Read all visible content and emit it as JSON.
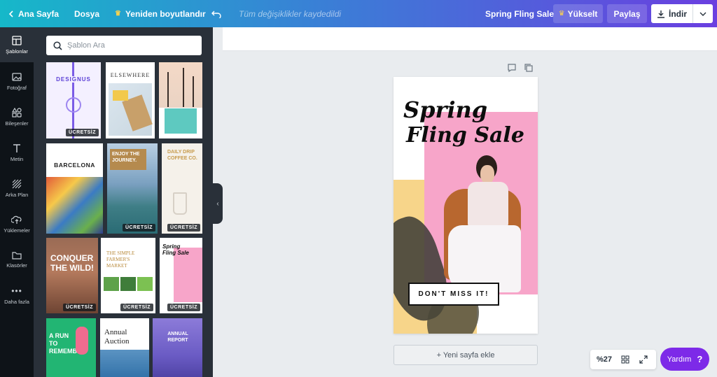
{
  "topbar": {
    "home_label": "Ana Sayfa",
    "file_label": "Dosya",
    "resize_label": "Yeniden boyutlandır",
    "saved_status": "Tüm değişiklikler kaydedildi",
    "doc_title": "Spring Fling Sale",
    "upgrade_label": "Yükselt",
    "share_label": "Paylaş",
    "download_label": "İndir"
  },
  "rail": {
    "items": [
      {
        "label": "Şablonlar",
        "icon": "template-icon"
      },
      {
        "label": "Fotoğraf",
        "icon": "photo-icon"
      },
      {
        "label": "Bileşenler",
        "icon": "elements-icon"
      },
      {
        "label": "Metin",
        "icon": "text-icon"
      },
      {
        "label": "Arka Plan",
        "icon": "background-icon"
      },
      {
        "label": "Yüklemeler",
        "icon": "upload-icon"
      },
      {
        "label": "Klasörler",
        "icon": "folder-icon"
      },
      {
        "label": "Daha fazla",
        "icon": "more-icon"
      }
    ]
  },
  "panel": {
    "search_placeholder": "Şablon Ara",
    "badge_free": "ÜCRETSİZ",
    "templates": {
      "t1": {
        "title": "DESIGNUS"
      },
      "t2": {
        "title": "ELSEWHERE"
      },
      "t4": {
        "title": "BARCELONA"
      },
      "t5": {
        "title": "ENJOY THE JOURNEY."
      },
      "t6": {
        "title": "DAILY DRIP COFFEE CO."
      },
      "t7": {
        "title": "CONQUER THE WILD!"
      },
      "t8": {
        "title": "THE SIMPLE FARMER'S MARKET"
      },
      "t9": {
        "title": "Spring Fling Sale"
      },
      "t10": {
        "title": "A RUN TO REMEMBER"
      },
      "t11": {
        "title": "Annual Auction"
      },
      "t12": {
        "title": "ANNUAL REPORT"
      }
    }
  },
  "canvas": {
    "headline_line1": "Spring",
    "headline_line2": "Fling Sale",
    "cta": "DON'T MISS IT!",
    "add_page": "+ Yeni sayfa ekle"
  },
  "zoom": {
    "level": "%27"
  },
  "help": {
    "label": "Yardım",
    "icon_glyph": "?"
  },
  "colors": {
    "accent_purple": "#7d2ae8",
    "pink": "#f7a5c9",
    "yellow": "#f7d58a"
  }
}
